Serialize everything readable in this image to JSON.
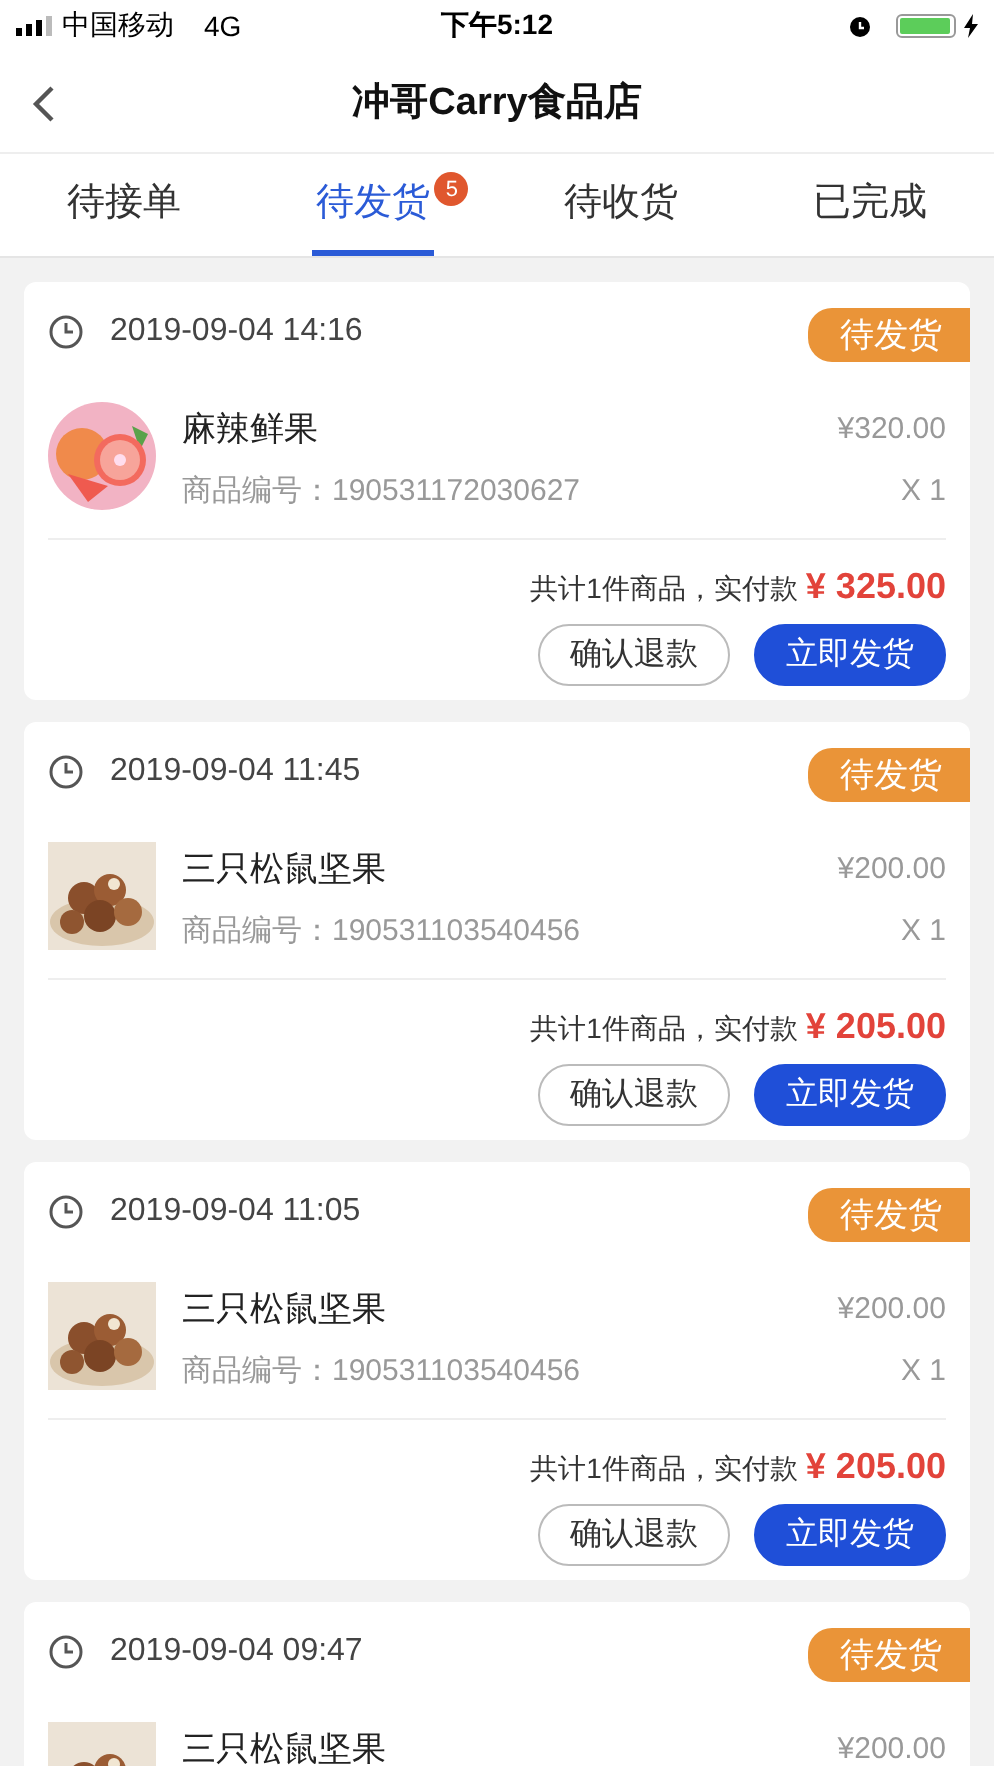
{
  "status_bar": {
    "carrier": "中国移动",
    "network": "4G",
    "time": "下午5:12"
  },
  "nav": {
    "title": "冲哥Carry食品店"
  },
  "tabs": [
    {
      "label": "待接单",
      "selected": false
    },
    {
      "label": "待发货",
      "selected": true,
      "badge": "5"
    },
    {
      "label": "待收货",
      "selected": false
    },
    {
      "label": "已完成",
      "selected": false
    }
  ],
  "orders": [
    {
      "time": "2019-09-04 14:16",
      "status": "待发货",
      "product": {
        "name": "麻辣鲜果",
        "code": "商品编号：190531172030627",
        "price": "¥320.00",
        "quantity": "X 1"
      },
      "summary": "共计1件商品，实付款",
      "total": "¥ 325.00",
      "buttons": [
        "确认退款",
        "立即发货"
      ]
    },
    {
      "time": "2019-09-04 11:45",
      "status": "待发货",
      "product": {
        "name": "三只松鼠坚果",
        "code": "商品编号：190531103540456",
        "price": "¥200.00",
        "quantity": "X 1"
      },
      "summary": "共计1件商品，实付款",
      "total": "¥ 205.00",
      "buttons": [
        "确认退款",
        "立即发货"
      ]
    },
    {
      "time": "2019-09-04 11:05",
      "status": "待发货",
      "product": {
        "name": "三只松鼠坚果",
        "code": "商品编号：190531103540456",
        "price": "¥200.00",
        "quantity": "X 1"
      },
      "summary": "共计1件商品，实付款",
      "total": "¥ 205.00",
      "buttons": [
        "确认退款",
        "立即发货"
      ]
    },
    {
      "time": "2019-09-04 09:47",
      "status": "待发货",
      "product": {
        "name": "三只松鼠坚果",
        "price": "¥200.00"
      }
    }
  ]
}
